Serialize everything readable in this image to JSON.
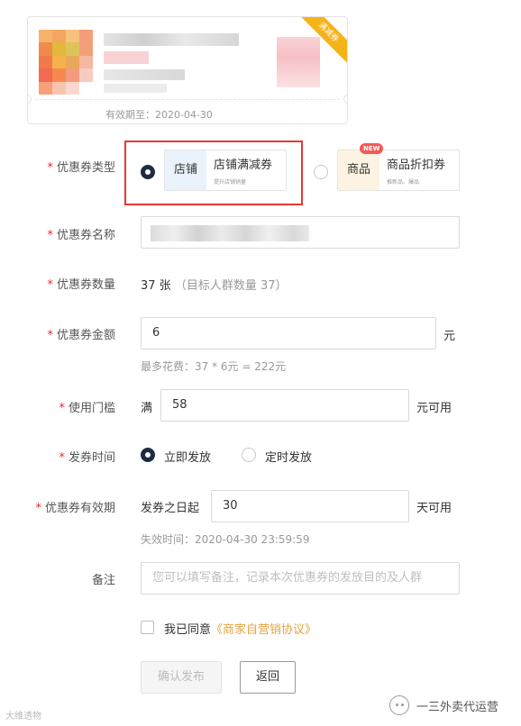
{
  "coupon_preview": {
    "ribbon": "满减券",
    "expire_label": "有效期至：",
    "expire_date": "2020-04-30"
  },
  "form": {
    "coupon_type": {
      "label": "优惠券类型",
      "options": [
        {
          "tag": "店铺",
          "title": "店铺满减券",
          "subtitle": "提升店铺销量",
          "checked": true
        },
        {
          "tag": "商品",
          "title": "商品折扣券",
          "subtitle": "推新品、爆品",
          "badge": "NEW",
          "checked": false
        }
      ]
    },
    "coupon_name": {
      "label": "优惠券名称"
    },
    "coupon_count": {
      "label": "优惠券数量",
      "value": "37 张",
      "target": "（目标人群数量 37）"
    },
    "coupon_amount": {
      "label": "优惠券金额",
      "value": "6",
      "unit": "元",
      "hint": "最多花费：37 * 6元 = 222元"
    },
    "threshold": {
      "label": "使用门槛",
      "prefix": "满",
      "value": "58",
      "suffix": "元可用"
    },
    "issue_time": {
      "label": "发券时间",
      "options": [
        {
          "label": "立即发放",
          "checked": true
        },
        {
          "label": "定时发放",
          "checked": false
        }
      ]
    },
    "validity": {
      "label": "优惠券有效期",
      "prefix": "发券之日起",
      "value": "30",
      "suffix": "天可用",
      "hint": "失效时间：2020-04-30 23:59:59"
    },
    "remark": {
      "label": "备注",
      "placeholder": "您可以填写备注，记录本次优惠券的发放目的及人群"
    },
    "agreement": {
      "text": "我已同意",
      "link": "《商家自营销协议》"
    },
    "buttons": {
      "confirm": "确认发布",
      "back": "返回"
    }
  },
  "watermarks": {
    "left": "大维透物",
    "right": "一三外卖代运营"
  },
  "colors": {
    "required": "#f5222d",
    "highlight_border": "#e53935",
    "link": "#e8a33c",
    "ribbon": "#f6b318",
    "radio_checked": "#1f2a44"
  }
}
